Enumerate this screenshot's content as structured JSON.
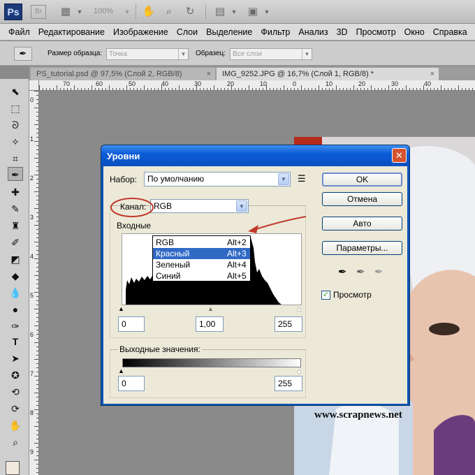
{
  "app": {
    "logo": "Ps",
    "bridge": "Br",
    "zoom": "100%"
  },
  "menu": [
    "Файл",
    "Редактирование",
    "Изображение",
    "Слои",
    "Выделение",
    "Фильтр",
    "Анализ",
    "3D",
    "Просмотр",
    "Окно",
    "Справка"
  ],
  "options": {
    "sample_size_label": "Размер образца:",
    "sample_size_value": "Точка",
    "sample_label": "Образец:",
    "sample_value": "Все слои"
  },
  "tabs": [
    {
      "label": "PS_tutorial.psd @ 97,5% (Слой 2, RGB/8)",
      "close": "×"
    },
    {
      "label": "IMG_9252.JPG @ 16,7% (Слой 1, RGB/8) *",
      "close": "×"
    }
  ],
  "ruler": {
    "h_labels": [
      "70",
      "60",
      "50",
      "40",
      "30",
      "20",
      "10",
      "0",
      "10",
      "20",
      "30",
      "40"
    ],
    "v_labels": [
      "0",
      "1",
      "2",
      "3",
      "4",
      "5",
      "6",
      "7",
      "8",
      "9"
    ]
  },
  "dialog": {
    "title": "Уровни",
    "close": "✕",
    "preset_label": "Набор:",
    "preset_value": "По умолчанию",
    "channel_label": "Канал:",
    "channel_value": "RGB",
    "input_label": "Входные",
    "channels": [
      {
        "name": "RGB",
        "key": "Alt+2"
      },
      {
        "name": "Красный",
        "key": "Alt+3"
      },
      {
        "name": "Зеленый",
        "key": "Alt+4"
      },
      {
        "name": "Синий",
        "key": "Alt+5"
      }
    ],
    "selected_channel_index": 1,
    "input_black": "0",
    "input_gamma": "1,00",
    "input_white": "255",
    "output_label": "Выходные значения:",
    "output_black": "0",
    "output_white": "255",
    "ok": "OK",
    "cancel": "Отмена",
    "auto": "Авто",
    "params": "Параметры...",
    "preview": "Просмотр",
    "preview_checked": true
  },
  "watermark": "www.scrapnews.net"
}
